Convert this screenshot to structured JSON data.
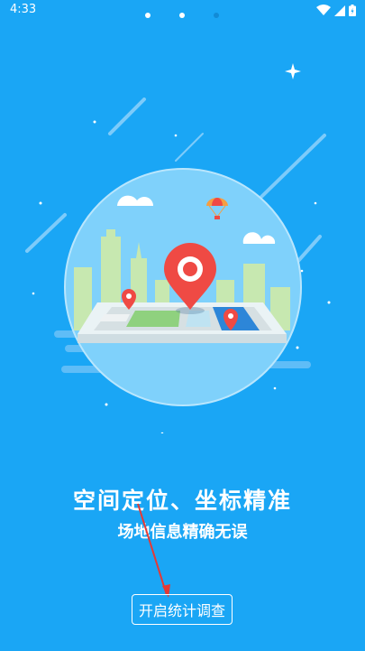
{
  "status_bar": {
    "time": "4:33"
  },
  "pager": {
    "total": 3,
    "active_index": 1
  },
  "content": {
    "headline": "空间定位、坐标精准",
    "subheadline": "场地信息精确无误"
  },
  "actions": {
    "start_button_label": "开启统计调查"
  },
  "colors": {
    "background": "#1aa6f5",
    "pin": "#ef4a44",
    "annotation_arrow": "#e53935"
  }
}
